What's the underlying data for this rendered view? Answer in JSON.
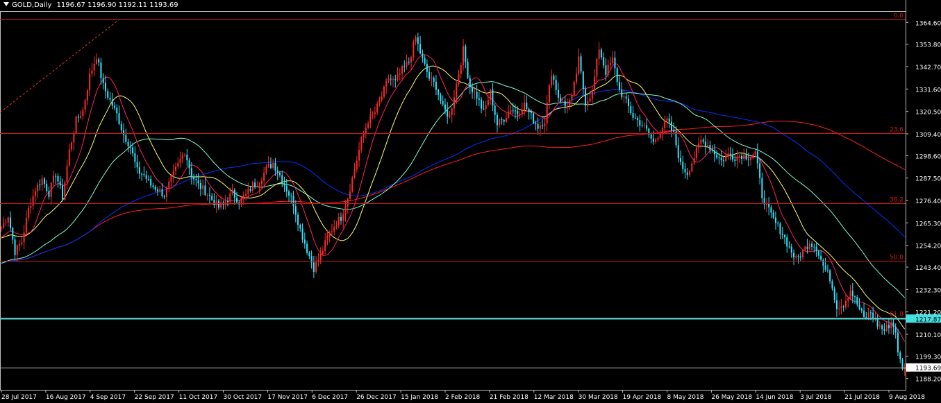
{
  "header": {
    "symbol": "GOLD,Daily",
    "open": "1196.67",
    "high": "1196.90",
    "low": "1192.11",
    "close": "1193.69"
  },
  "chart_data": {
    "type": "candlestick",
    "symbol": "GOLD",
    "timeframe": "Daily",
    "ylim": [
      1182.6,
      1370.2
    ],
    "y_ticks": [
      "1364.60",
      "1353.80",
      "1342.70",
      "1331.60",
      "1320.50",
      "1309.40",
      "1298.60",
      "1287.50",
      "1276.40",
      "1265.30",
      "1254.20",
      "1243.40",
      "1232.30",
      "1221.20",
      "1210.10",
      "1199.30",
      "1188.20"
    ],
    "x_ticks": [
      "28 Jul 2017",
      "16 Aug 2017",
      "4 Sep 2017",
      "22 Sep 2017",
      "11 Oct 2017",
      "30 Oct 2017",
      "17 Nov 2017",
      "6 Dec 2017",
      "26 Dec 2017",
      "15 Jan 2018",
      "2 Feb 2018",
      "21 Feb 2018",
      "12 Mar 2018",
      "30 Mar 2018",
      "19 Apr 2018",
      "8 May 2018",
      "26 May 2018",
      "14 Jun 2018",
      "3 Jul 2018",
      "21 Jul 2018",
      "9 Aug 2018"
    ],
    "fibonacci": [
      {
        "label": "0.0",
        "price": 1366.0
      },
      {
        "label": "23.6",
        "price": 1309.8
      },
      {
        "label": "38.2",
        "price": 1274.9
      },
      {
        "label": "50.0",
        "price": 1246.6
      },
      {
        "label": "61.8",
        "price": 1218.5
      }
    ],
    "hlines": [
      {
        "price": 1217.87,
        "label": "1217.87",
        "color": "#40e0e0"
      },
      {
        "price": 1193.69,
        "label": "1193.69",
        "color": "#c0c0c0"
      }
    ],
    "colors": {
      "bull": "#ff2a2a",
      "bear": "#2ee6ff",
      "fib": "#d01818"
    },
    "ohlc_anchors": [
      [
        0,
        1263
      ],
      [
        3,
        1269
      ],
      [
        6,
        1251
      ],
      [
        9,
        1256
      ],
      [
        12,
        1272
      ],
      [
        15,
        1282
      ],
      [
        18,
        1287
      ],
      [
        21,
        1280
      ],
      [
        24,
        1290
      ],
      [
        27,
        1278
      ],
      [
        30,
        1301
      ],
      [
        33,
        1316
      ],
      [
        36,
        1321
      ],
      [
        39,
        1338
      ],
      [
        42,
        1348
      ],
      [
        45,
        1333
      ],
      [
        48,
        1326
      ],
      [
        51,
        1319
      ],
      [
        54,
        1309
      ],
      [
        57,
        1303
      ],
      [
        60,
        1291
      ],
      [
        63,
        1289
      ],
      [
        66,
        1284
      ],
      [
        69,
        1282
      ],
      [
        72,
        1279
      ],
      [
        75,
        1287
      ],
      [
        78,
        1294
      ],
      [
        81,
        1301
      ],
      [
        84,
        1289
      ],
      [
        87,
        1284
      ],
      [
        90,
        1281
      ],
      [
        93,
        1277
      ],
      [
        96,
        1273
      ],
      [
        99,
        1276
      ],
      [
        102,
        1280
      ],
      [
        105,
        1276
      ],
      [
        108,
        1279
      ],
      [
        111,
        1284
      ],
      [
        114,
        1286
      ],
      [
        117,
        1292
      ],
      [
        120,
        1295
      ],
      [
        123,
        1289
      ],
      [
        126,
        1282
      ],
      [
        129,
        1275
      ],
      [
        132,
        1262
      ],
      [
        135,
        1252
      ],
      [
        138,
        1243
      ],
      [
        141,
        1249
      ],
      [
        144,
        1258
      ],
      [
        147,
        1264
      ],
      [
        150,
        1268
      ],
      [
        153,
        1278
      ],
      [
        156,
        1292
      ],
      [
        159,
        1306
      ],
      [
        162,
        1316
      ],
      [
        165,
        1320
      ],
      [
        168,
        1328
      ],
      [
        171,
        1337
      ],
      [
        174,
        1335
      ],
      [
        177,
        1341
      ],
      [
        180,
        1345
      ],
      [
        183,
        1357
      ],
      [
        186,
        1346
      ],
      [
        189,
        1337
      ],
      [
        192,
        1333
      ],
      [
        195,
        1322
      ],
      [
        198,
        1318
      ],
      [
        201,
        1334
      ],
      [
        204,
        1351
      ],
      [
        207,
        1333
      ],
      [
        210,
        1328
      ],
      [
        213,
        1320
      ],
      [
        216,
        1330
      ],
      [
        219,
        1314
      ],
      [
        222,
        1317
      ],
      [
        225,
        1322
      ],
      [
        228,
        1320
      ],
      [
        231,
        1324
      ],
      [
        234,
        1318
      ],
      [
        237,
        1313
      ],
      [
        240,
        1316
      ],
      [
        243,
        1340
      ],
      [
        246,
        1328
      ],
      [
        249,
        1323
      ],
      [
        252,
        1327
      ],
      [
        255,
        1346
      ],
      [
        258,
        1325
      ],
      [
        261,
        1330
      ],
      [
        264,
        1352
      ],
      [
        267,
        1340
      ],
      [
        270,
        1346
      ],
      [
        273,
        1331
      ],
      [
        276,
        1325
      ],
      [
        279,
        1318
      ],
      [
        282,
        1315
      ],
      [
        285,
        1311
      ],
      [
        288,
        1305
      ],
      [
        291,
        1311
      ],
      [
        294,
        1316
      ],
      [
        297,
        1309
      ],
      [
        300,
        1294
      ],
      [
        303,
        1290
      ],
      [
        306,
        1298
      ],
      [
        309,
        1306
      ],
      [
        312,
        1304
      ],
      [
        315,
        1300
      ],
      [
        318,
        1296
      ],
      [
        321,
        1299
      ],
      [
        324,
        1298
      ],
      [
        327,
        1299
      ],
      [
        330,
        1298
      ],
      [
        333,
        1300
      ],
      [
        336,
        1279
      ],
      [
        339,
        1271
      ],
      [
        342,
        1265
      ],
      [
        345,
        1260
      ],
      [
        348,
        1253
      ],
      [
        351,
        1247
      ],
      [
        354,
        1251
      ],
      [
        357,
        1256
      ],
      [
        360,
        1253
      ],
      [
        363,
        1244
      ],
      [
        366,
        1238
      ],
      [
        369,
        1224
      ],
      [
        372,
        1225
      ],
      [
        375,
        1232
      ],
      [
        378,
        1225
      ],
      [
        381,
        1218
      ],
      [
        384,
        1221
      ],
      [
        387,
        1215
      ],
      [
        390,
        1212
      ],
      [
        393,
        1216
      ],
      [
        395,
        1212
      ],
      [
        396,
        1200
      ],
      [
        398,
        1194
      ]
    ],
    "moving_averages": [
      {
        "color": "#ff2020",
        "period": 200
      },
      {
        "color": "#0033ff",
        "period": 100
      },
      {
        "color": "#7fffd4",
        "period": 50
      },
      {
        "color": "#ffff66",
        "period": 21
      },
      {
        "color": "#ff2060",
        "period": 10
      }
    ],
    "trendline": {
      "color": "#ff3030",
      "style": "dashed"
    }
  }
}
